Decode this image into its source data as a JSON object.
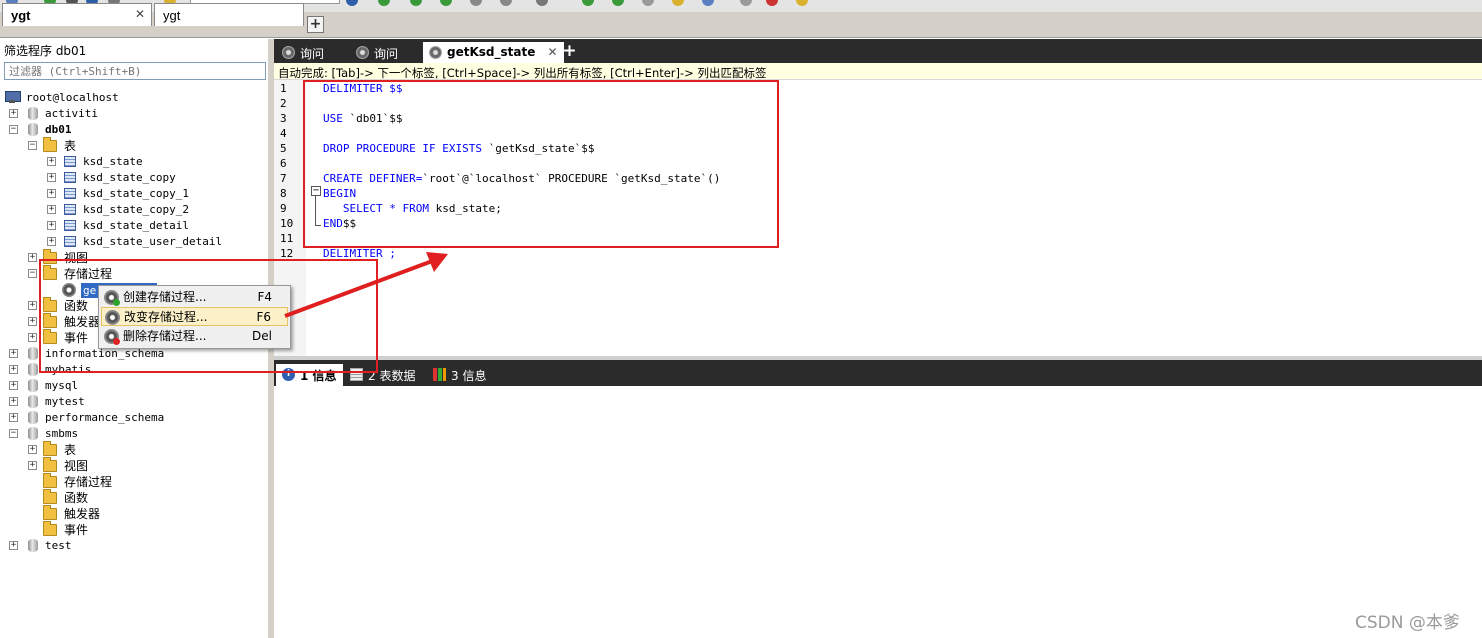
{
  "connection_tabs": [
    {
      "label": "ygt",
      "close": "✕",
      "active": true
    },
    {
      "label": "ygt",
      "active": false
    }
  ],
  "add_tab_symbol": "+",
  "left_panel": {
    "header": "筛选程序 db01",
    "filter_placeholder": "过滤器 (Ctrl+Shift+B)",
    "tree": {
      "root": "root@localhost",
      "activiti": "activiti",
      "db01": "db01",
      "db01_tables": "表",
      "tables": [
        "ksd_state",
        "ksd_state_copy",
        "ksd_state_copy_1",
        "ksd_state_copy_2",
        "ksd_state_detail",
        "ksd_state_user_detail"
      ],
      "db01_views": "视图",
      "db01_procs": "存储过程",
      "selected_proc": "ge",
      "db01_funcs": "函数",
      "db01_triggers": "触发器",
      "db01_events": "事件",
      "information_schema": "information_schema",
      "mybatis": "mybatis",
      "mysql": "mysql",
      "mytest": "mytest",
      "performance_schema": "performance_schema",
      "smbms": "smbms",
      "smbms_tables": "表",
      "smbms_views": "视图",
      "smbms_procs": "存储过程",
      "smbms_funcs": "函数",
      "smbms_triggers": "触发器",
      "smbms_events": "事件",
      "test": "test"
    }
  },
  "context_menu": [
    {
      "label": "创建存储过程...",
      "shortcut": "F4",
      "icon": "proc-add-icon"
    },
    {
      "label": "改变存储过程...",
      "shortcut": "F6",
      "icon": "proc-alter-icon",
      "highlighted": true
    },
    {
      "label": "删除存储过程...",
      "shortcut": "Del",
      "icon": "proc-delete-icon"
    }
  ],
  "editor_tabs": [
    {
      "label": "询问",
      "active": false
    },
    {
      "label": "询问",
      "active": false
    },
    {
      "label": "getKsd_state",
      "close": "✕",
      "active": true
    }
  ],
  "hint_bar": "自动完成: [Tab]-> 下一个标签, [Ctrl+Space]-> 列出所有标签, [Ctrl+Enter]-> 列出匹配标签",
  "code_lines": [
    {
      "n": "1",
      "kw": "DELIMITER",
      "rest": " $$"
    },
    {
      "n": "2",
      "kw": "",
      "rest": ""
    },
    {
      "n": "3",
      "kw": "USE",
      "rest": " `db01`$$"
    },
    {
      "n": "4",
      "kw": "",
      "rest": ""
    },
    {
      "n": "5",
      "kw": "DROP PROCEDURE IF EXISTS",
      "rest": " `getKsd_state`$$"
    },
    {
      "n": "6",
      "kw": "",
      "rest": ""
    },
    {
      "n": "7",
      "kw": "CREATE DEFINER=",
      "rest": "`root`@`localhost` PROCEDURE `getKsd_state`()"
    },
    {
      "n": "8",
      "kw": "BEGIN",
      "rest": ""
    },
    {
      "n": "9",
      "kw": "   SELECT * FROM",
      "rest": " ksd_state;"
    },
    {
      "n": "10",
      "kw": "END",
      "rest": "$$"
    },
    {
      "n": "11",
      "kw": "",
      "rest": ""
    },
    {
      "n": "12",
      "kw": "DELIMITER",
      "rest": " ;"
    }
  ],
  "fold_symbol": "−",
  "bottom_tabs": [
    {
      "label": "1 信息",
      "active": true,
      "icon": "info-icon"
    },
    {
      "label": "2 表数据",
      "active": false,
      "icon": "table-data-icon"
    },
    {
      "label": "3 信息",
      "active": false,
      "icon": "chart-icon"
    }
  ],
  "info_glyph": "i",
  "colors": {
    "keyword": "#0000ff",
    "annotation": "#e02020",
    "selection": "#316ac5"
  },
  "watermark": "CSDN @本爹"
}
